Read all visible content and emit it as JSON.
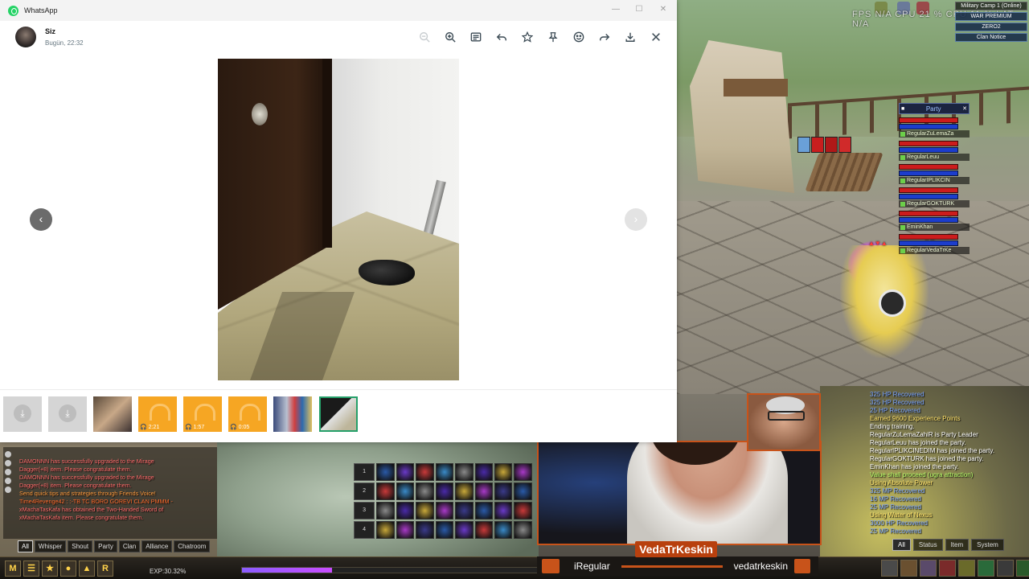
{
  "whatsapp": {
    "app_title": "WhatsApp",
    "window_controls": {
      "minimize": "—",
      "maximize": "☐",
      "close": "✕"
    },
    "sender": "Siz",
    "time": "Bugün, 22:32",
    "toolbar_icons": [
      "zoom-out-icon",
      "zoom-in-icon",
      "details-icon",
      "reply-icon",
      "star-icon",
      "pin-icon",
      "emoji-icon",
      "forward-icon",
      "download-icon",
      "close-icon"
    ],
    "nav": {
      "prev": "‹",
      "next": "›"
    },
    "thumbnails": [
      {
        "kind": "download"
      },
      {
        "kind": "download"
      },
      {
        "kind": "photo"
      },
      {
        "kind": "audio",
        "duration": "2:21"
      },
      {
        "kind": "audio",
        "duration": "1:57"
      },
      {
        "kind": "audio",
        "duration": "0:05"
      },
      {
        "kind": "photo"
      },
      {
        "kind": "photo",
        "selected": true
      }
    ]
  },
  "game": {
    "server_box": [
      "Military Camp 1 (Online)",
      "WAR PREMIUM",
      "ZERO2",
      "Clan Notice"
    ],
    "fps_text": "FPS N/A   CPU 21 %   CPU 11 %   LAT N/A",
    "party": {
      "title": "Party",
      "members": [
        "RegularZuLemaZa",
        "RegularLeuu",
        "RegularIPLIKCIN",
        "RegularGOKTURK",
        "EminKhan",
        "RegularVedaTrKe"
      ]
    },
    "chat_left": [
      {
        "text": "DAMONNN has successfully upgraded to the Mirage",
        "color": "#ff6a6a"
      },
      {
        "text": "Dagger(+8) item. Please congratulate them.",
        "color": "#ff6a6a"
      },
      {
        "text": "DAMONNN has successfully upgraded to the Mirage",
        "color": "#ff6a6a"
      },
      {
        "text": "Dagger(+8) item. Please congratulate them.",
        "color": "#ff6a6a"
      },
      {
        "text": "Send quick tips and strategies through Friends Voice!",
        "color": "#ff9a3c"
      },
      {
        "text": "Time4Revenge42 : :-TB TC BORO GOREVI CLAN PMMM -",
        "color": "#ff6a2a"
      },
      {
        "text": "xMachaTasKafa has obtained the Two-Handed Sword of",
        "color": "#ff6a6a"
      },
      {
        "text": "xMachaTasKafa item. Please congratulate them.",
        "color": "#ff6a6a"
      }
    ],
    "chat_left_tabs": [
      "All",
      "Whisper",
      "Shout",
      "Party",
      "Clan",
      "Alliance",
      "Chatroom"
    ],
    "chat_right": [
      {
        "text": "325 HP Recovered",
        "color": "#7aa4ff"
      },
      {
        "text": "325 HP Recovered",
        "color": "#7aa4ff"
      },
      {
        "text": "25 HP Recovered",
        "color": "#7aa4ff"
      },
      {
        "text": "Earned 9600 Experience Points",
        "color": "#ffe26a"
      },
      {
        "text": "Ending training.",
        "color": "#ffffff"
      },
      {
        "text": "RegularZuLemaZahiR is Party Leader",
        "color": "#ffffff"
      },
      {
        "text": "RegularLeuu has joined the party.",
        "color": "#ffffff"
      },
      {
        "text": "RegularIPLIKCINEDIM has joined the party.",
        "color": "#ffffff"
      },
      {
        "text": "RegularGOKTURK has joined the party.",
        "color": "#ffffff"
      },
      {
        "text": "EminKhan has joined the party.",
        "color": "#ffffff"
      },
      {
        "text": "Value shall proceed (ugra attraction)",
        "color": "#b9ff6a"
      },
      {
        "text": "Using Absolute Power",
        "color": "#ffe26a"
      },
      {
        "text": "325 MP Recovered",
        "color": "#7aa4ff"
      },
      {
        "text": "16 MP Recovered",
        "color": "#7aa4ff"
      },
      {
        "text": "25 MP Recovered",
        "color": "#7aa4ff"
      },
      {
        "text": "Using Water of Nexus",
        "color": "#ffe26a"
      },
      {
        "text": "3000 HP Recovered",
        "color": "#7aa4ff"
      },
      {
        "text": "25 MP Recovered",
        "color": "#7aa4ff"
      }
    ],
    "chat_right_tabs": [
      "All",
      "Status",
      "Item",
      "System"
    ],
    "skill_rows": [
      "1",
      "2",
      "3",
      "4"
    ],
    "menu_icons": [
      "M",
      "☰",
      "★",
      "●",
      "▲",
      "R"
    ],
    "exp_text": "EXP:30.32%",
    "exp_progress": 0.3032
  },
  "stream": {
    "title": "VedaTrKeskin",
    "user_left": "iRegular",
    "user_right": "vedatrkeskin"
  },
  "colors": {
    "wa_green": "#25d366",
    "stream_orange": "#c8531a"
  }
}
